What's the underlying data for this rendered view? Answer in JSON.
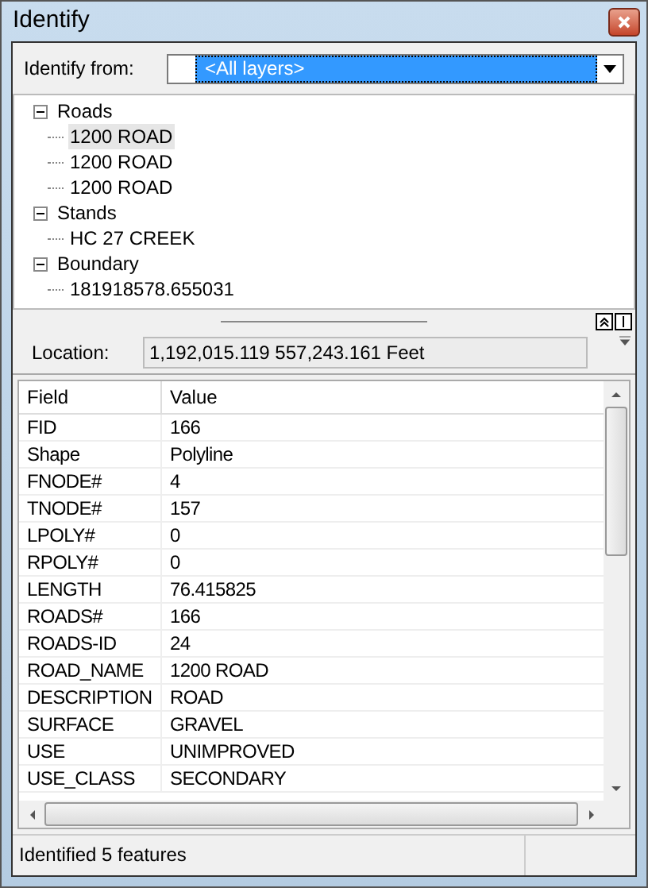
{
  "window": {
    "title": "Identify"
  },
  "identify_from": {
    "label": "Identify from:",
    "value": "<All layers>"
  },
  "tree": [
    {
      "label": "Roads",
      "expanded": true,
      "children": [
        {
          "label": "1200 ROAD",
          "selected": true
        },
        {
          "label": "1200 ROAD",
          "selected": false
        },
        {
          "label": "1200 ROAD",
          "selected": false
        }
      ]
    },
    {
      "label": "Stands",
      "expanded": true,
      "children": [
        {
          "label": "HC 27 CREEK",
          "selected": false
        }
      ]
    },
    {
      "label": "Boundary",
      "expanded": true,
      "children": [
        {
          "label": "181918578.655031",
          "selected": false
        }
      ]
    }
  ],
  "location": {
    "label": "Location:",
    "value": "1,192,015.119  557,243.161 Feet"
  },
  "table": {
    "columns": [
      "Field",
      "Value"
    ],
    "rows": [
      [
        "FID",
        "166"
      ],
      [
        "Shape",
        "Polyline"
      ],
      [
        "FNODE#",
        "4"
      ],
      [
        "TNODE#",
        "157"
      ],
      [
        "LPOLY#",
        "0"
      ],
      [
        "RPOLY#",
        "0"
      ],
      [
        "LENGTH",
        "76.415825"
      ],
      [
        "ROADS#",
        "166"
      ],
      [
        "ROADS-ID",
        "24"
      ],
      [
        "ROAD_NAME",
        "1200 ROAD"
      ],
      [
        "DESCRIPTION",
        "ROAD"
      ],
      [
        "SURFACE",
        "GRAVEL"
      ],
      [
        "USE",
        "UNIMPROVED"
      ],
      [
        "USE_CLASS",
        "SECONDARY"
      ]
    ]
  },
  "status_bar": "Identified 5 features"
}
